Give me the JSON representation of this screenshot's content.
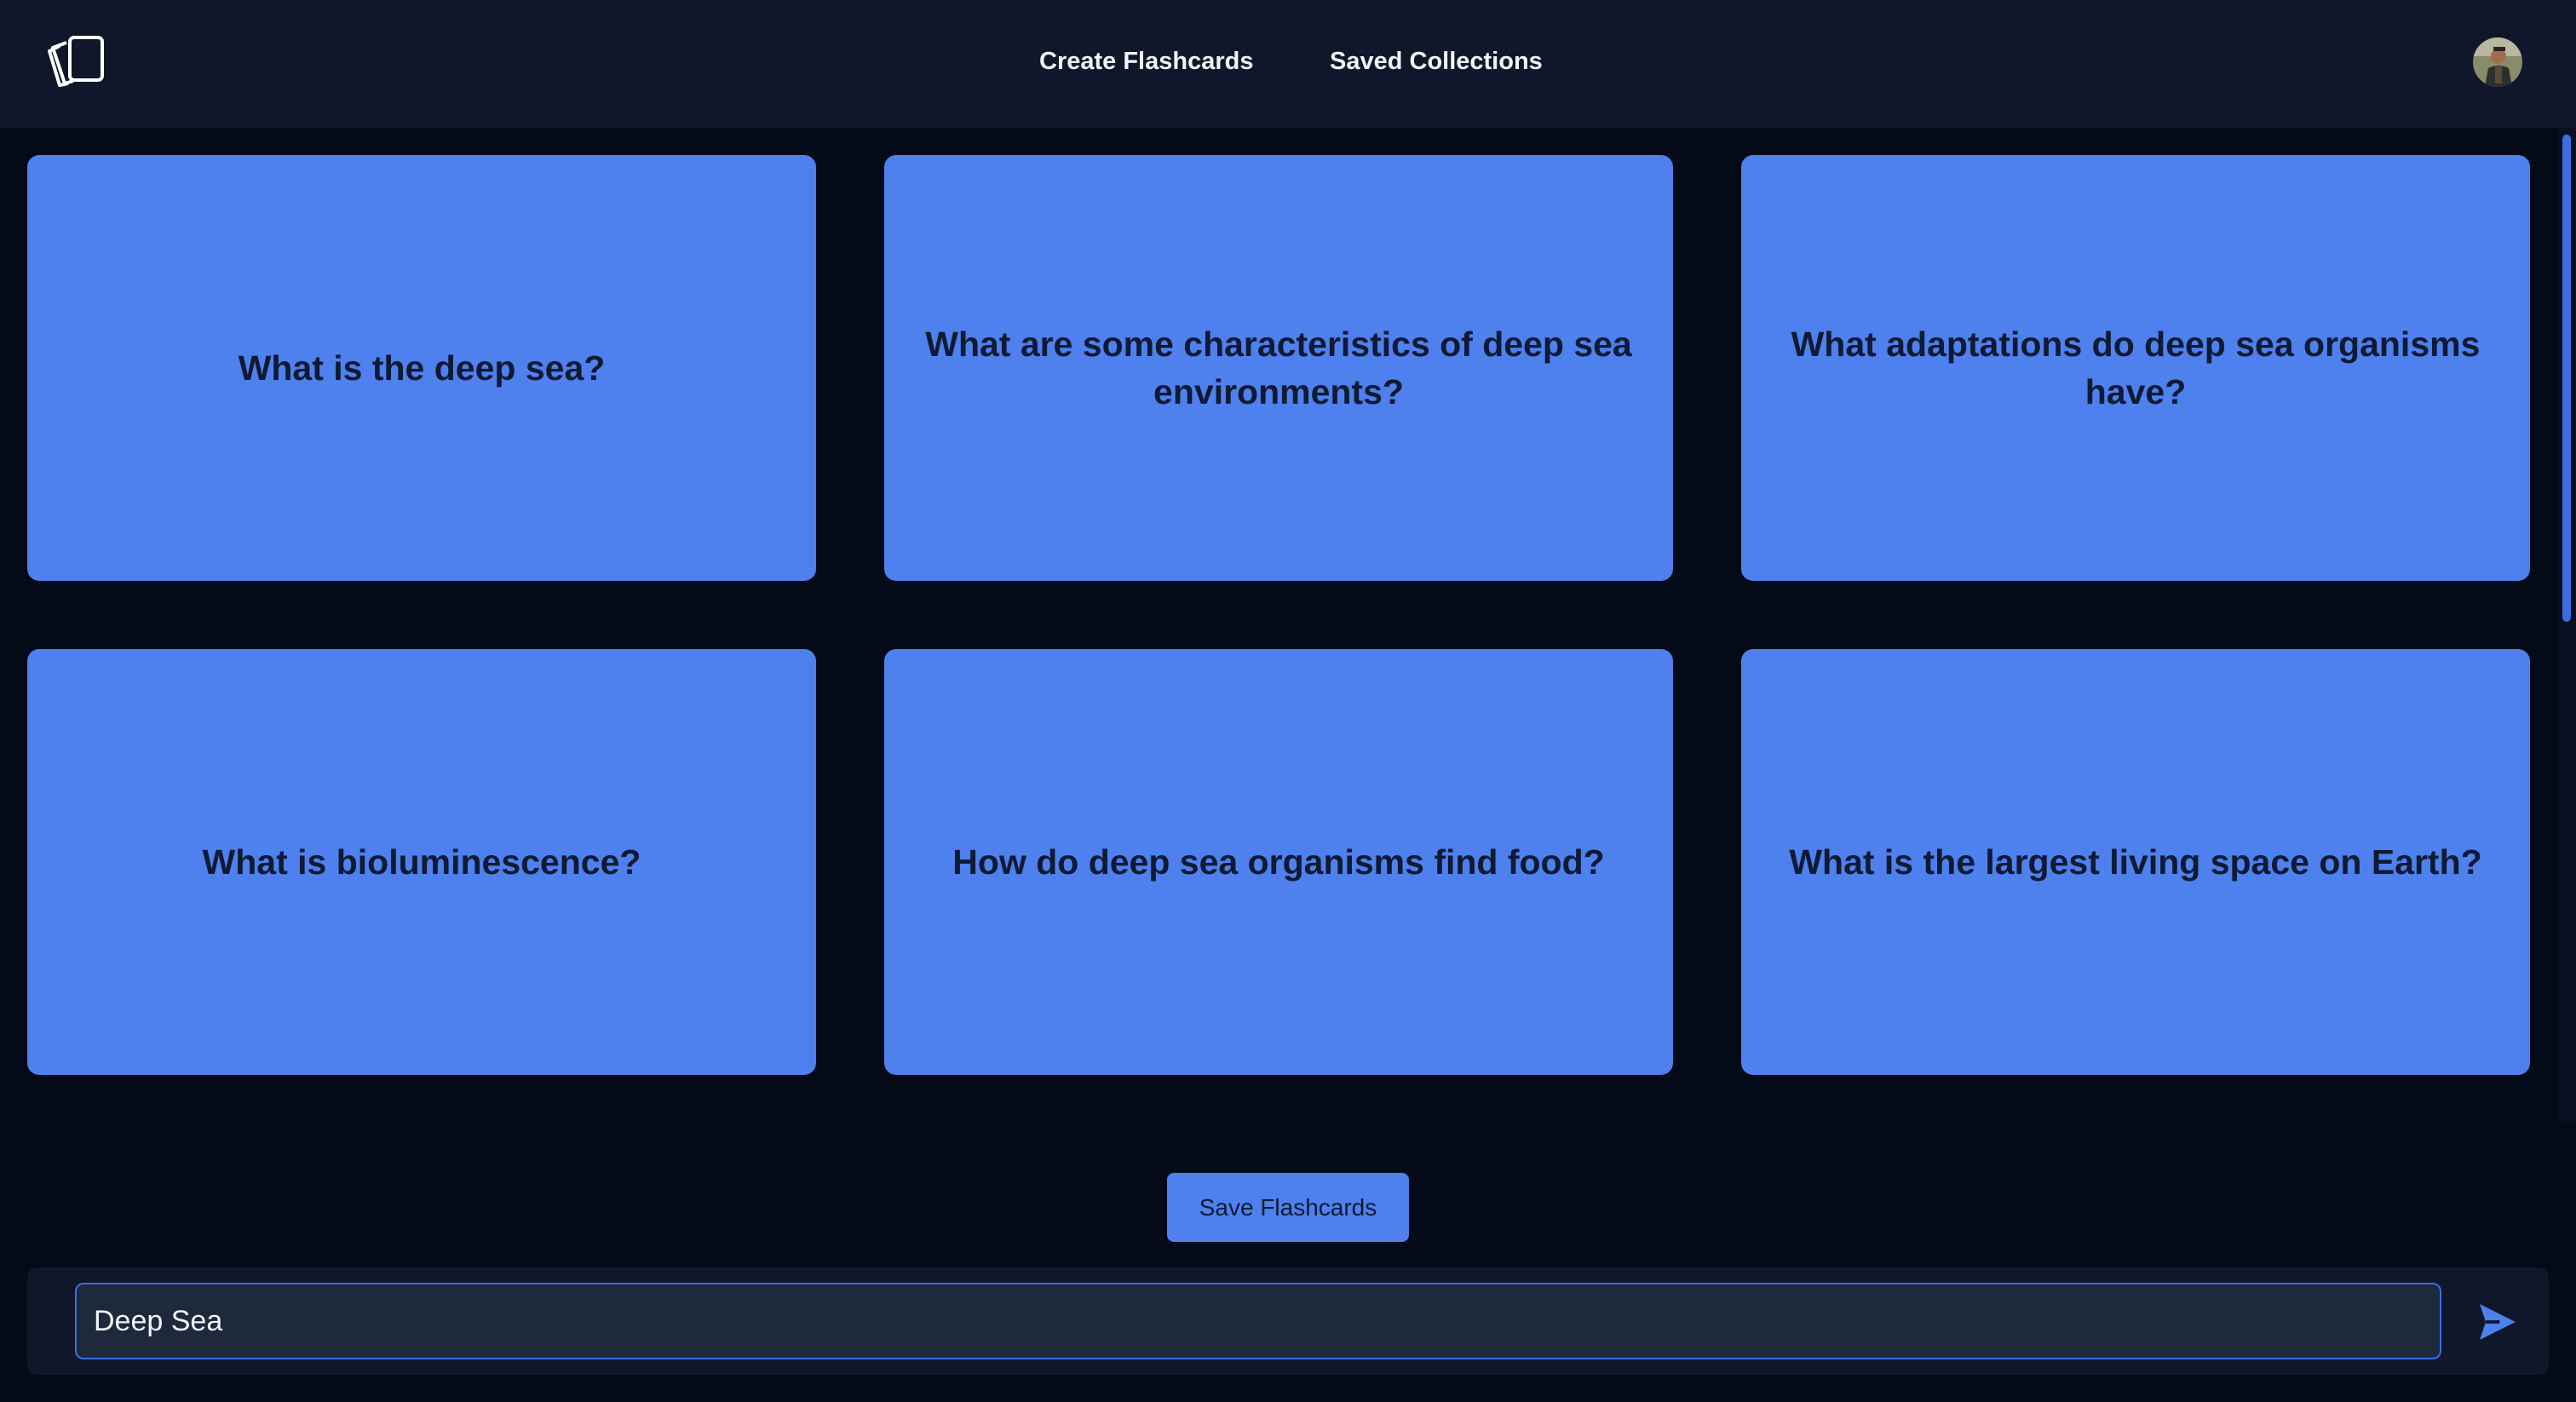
{
  "nav": {
    "logo_icon": "cards-stack-icon",
    "links": [
      {
        "label": "Create Flashcards"
      },
      {
        "label": "Saved Collections"
      }
    ],
    "avatar_icon": "user-avatar"
  },
  "cards": [
    {
      "question": "What is the deep sea?"
    },
    {
      "question": "What are some characteristics of deep sea environments?"
    },
    {
      "question": "What adaptations do deep sea organisms have?"
    },
    {
      "question": "What is bioluminescence?"
    },
    {
      "question": "How do deep sea organisms find food?"
    },
    {
      "question": "What is the largest living space on Earth?"
    }
  ],
  "save_button": {
    "label": "Save Flashcards"
  },
  "prompt": {
    "value": "Deep Sea",
    "send_icon": "send-icon"
  },
  "colors": {
    "background": "#050a18",
    "navbar": "#10172a",
    "card": "#4e80ee",
    "card_text": "#0f1a33",
    "accent": "#3b6fe0"
  }
}
